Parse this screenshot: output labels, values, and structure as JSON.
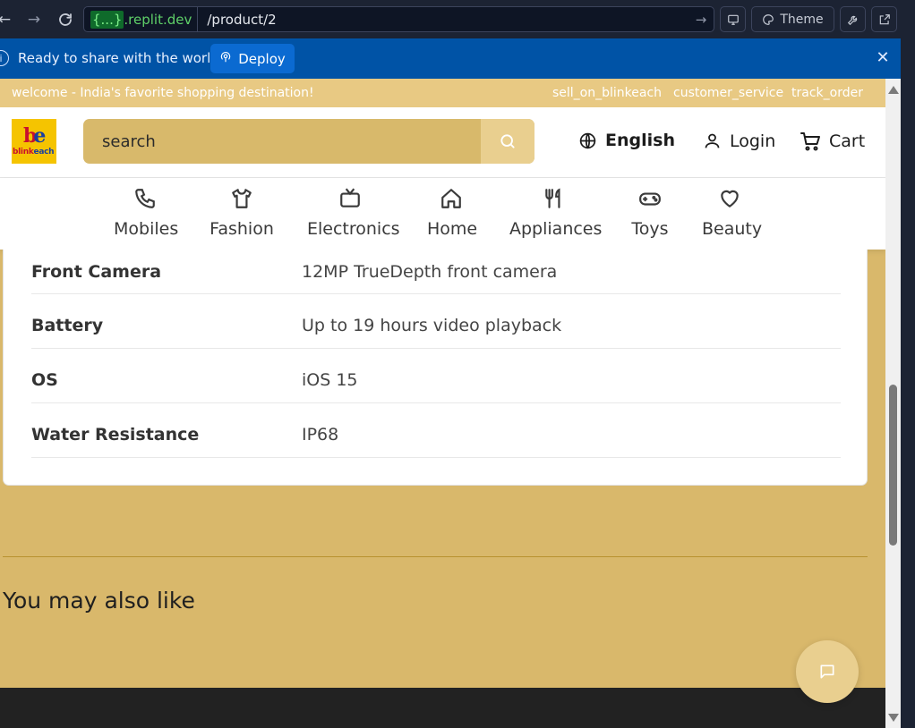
{
  "browser": {
    "url_host": ".replit.dev",
    "url_host_badge": "{...}",
    "url_path": "/product/2",
    "theme_label": "Theme"
  },
  "deploy_banner": {
    "message": "Ready to share with the world?",
    "deploy_label": "Deploy"
  },
  "promo": {
    "welcome": "welcome - India's favorite shopping destination!",
    "links": [
      "sell_on_blinkeach",
      "customer_service",
      "track_order"
    ]
  },
  "header": {
    "logo_word_a": "blink",
    "logo_word_b": "each",
    "search_placeholder": "search",
    "language": "English",
    "login": "Login",
    "cart": "Cart"
  },
  "categories": [
    {
      "label": "Mobiles",
      "icon": "phone-icon"
    },
    {
      "label": "Fashion",
      "icon": "shirt-icon"
    },
    {
      "label": "Electronics",
      "icon": "tv-icon"
    },
    {
      "label": "Home",
      "icon": "house-icon"
    },
    {
      "label": "Appliances",
      "icon": "utensils-icon"
    },
    {
      "label": "Toys",
      "icon": "gamepad-icon"
    },
    {
      "label": "Beauty",
      "icon": "heart-icon"
    }
  ],
  "specs": [
    {
      "key": "Front Camera",
      "value": "12MP TrueDepth front camera"
    },
    {
      "key": "Battery",
      "value": "Up to 19 hours video playback"
    },
    {
      "key": "OS",
      "value": "iOS 15"
    },
    {
      "key": "Water Resistance",
      "value": "IP68"
    }
  ],
  "related": {
    "title": "You may also like"
  },
  "colors": {
    "accent": "#d9b86b",
    "promo_bar": "#e8c983",
    "deploy_banner": "#0053a6",
    "footer": "#222222"
  }
}
